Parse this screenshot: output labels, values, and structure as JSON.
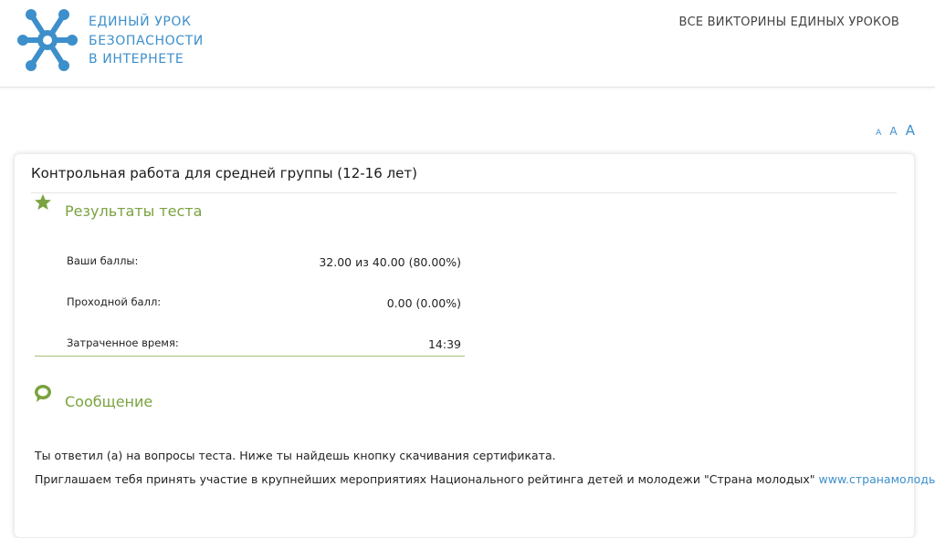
{
  "colors": {
    "brand_blue": "#3d8fcb",
    "accent_green": "#7aa23f"
  },
  "header": {
    "logo_lines": [
      "ЕДИНЫЙ УРОК",
      "БЕЗОПАСНОСТИ",
      "В ИНТЕРНЕТЕ"
    ],
    "logo_icon": "molecule-logo-icon",
    "nav_link": "ВСЕ ВИКТОРИНЫ ЕДИНЫХ УРОКОВ"
  },
  "font_size_switcher": {
    "small": "A",
    "medium": "A",
    "large": "A"
  },
  "card": {
    "title": "Контрольная работа для средней группы (12-16 лет)",
    "results": {
      "icon": "star-icon",
      "title": "Результаты теста",
      "rows": [
        {
          "label": "Ваши баллы:",
          "value": "32.00 из 40.00 (80.00%)"
        },
        {
          "label": "Проходной балл:",
          "value": "0.00 (0.00%)"
        },
        {
          "label": "Затраченное время:",
          "value": "14:39"
        }
      ]
    },
    "message": {
      "icon": "speech-bubble-icon",
      "title": "Сообщение",
      "line1": "Ты ответил (а) на вопросы теста. Ниже ты найдешь кнопку скачивания сертификата.",
      "line2_text": "Приглашаем тебя принять участие в крупнейших мероприятиях Национального рейтинга детей и молодежи \"Страна молодых\" ",
      "line2_link": "www.странамолодых.рф"
    }
  }
}
